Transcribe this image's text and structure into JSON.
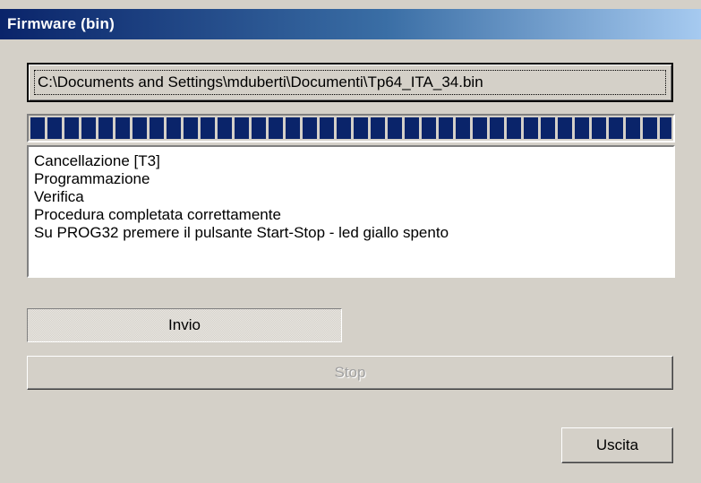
{
  "window": {
    "title": "Firmware (bin)"
  },
  "file": {
    "path": "C:\\Documents and Settings\\mduberti\\Documenti\\Tp64_ITA_34.bin"
  },
  "progress": {
    "percent": 100
  },
  "log": {
    "lines": [
      "Cancellazione [T3]",
      "Programmazione",
      "Verifica",
      "Procedura completata correttamente",
      "Su PROG32 premere il pulsante Start-Stop - led giallo spento"
    ]
  },
  "buttons": {
    "invio_label": "Invio",
    "stop_label": "Stop",
    "uscita_label": "Uscita"
  },
  "colors": {
    "progress_fill": "#0a246a",
    "disabled_text": "#a0a0a0"
  }
}
